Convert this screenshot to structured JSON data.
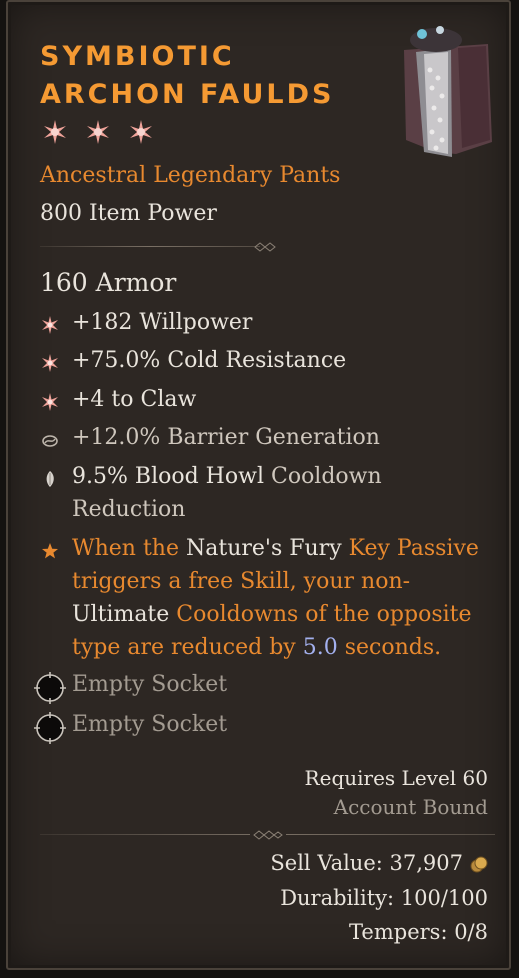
{
  "item": {
    "name_line1": "Symbiotic",
    "name_line2": "Archon Faulds",
    "star_icons": [
      "star-burst-icon",
      "star-burst-icon",
      "star-burst-icon"
    ],
    "type": "Ancestral Legendary Pants",
    "item_power": "800 Item Power",
    "image_icon": "faulds-armor-icon"
  },
  "stats": {
    "armor": "160 Armor",
    "affixes": [
      {
        "icon": "greater-affix-icon",
        "text": "+182 Willpower"
      },
      {
        "icon": "greater-affix-icon",
        "text": "+75.0% Cold Resistance"
      },
      {
        "icon": "greater-affix-icon",
        "text": "+4 to Claw"
      },
      {
        "icon": "tempered-affix-icon",
        "text": "+12.0% Barrier Generation"
      }
    ],
    "aspect": {
      "icon": "unique-aspect-icon",
      "value": "9.5%",
      "skill": "Blood Howl",
      "suffix": "Cooldown",
      "line2": "Reduction"
    },
    "legendary": {
      "icon": "legendary-star-icon",
      "l1_a": "When the",
      "l1_b": "Nature's Fury",
      "l1_c": "Key Passive",
      "l2": "triggers a free Skill, your non-",
      "l3_a": "Ultimate",
      "l3_b": "Cooldowns of the opposite",
      "l4_a": "type are reduced by",
      "l4_b": "5.0",
      "l4_c": "seconds."
    },
    "sockets": [
      "Empty Socket",
      "Empty Socket"
    ]
  },
  "requirements": {
    "level": "Requires Level 60",
    "binding": "Account Bound"
  },
  "footer": {
    "sell_value": "Sell Value: 37,907",
    "coin_icon": "gold-coin-icon",
    "durability": "Durability: 100/100",
    "tempers": "Tempers: 0/8"
  },
  "colors": {
    "legendary_orange": "#e8892f",
    "title_orange": "#f59a33",
    "value_blue": "#a3b0ee",
    "panel": "#2d2723"
  }
}
